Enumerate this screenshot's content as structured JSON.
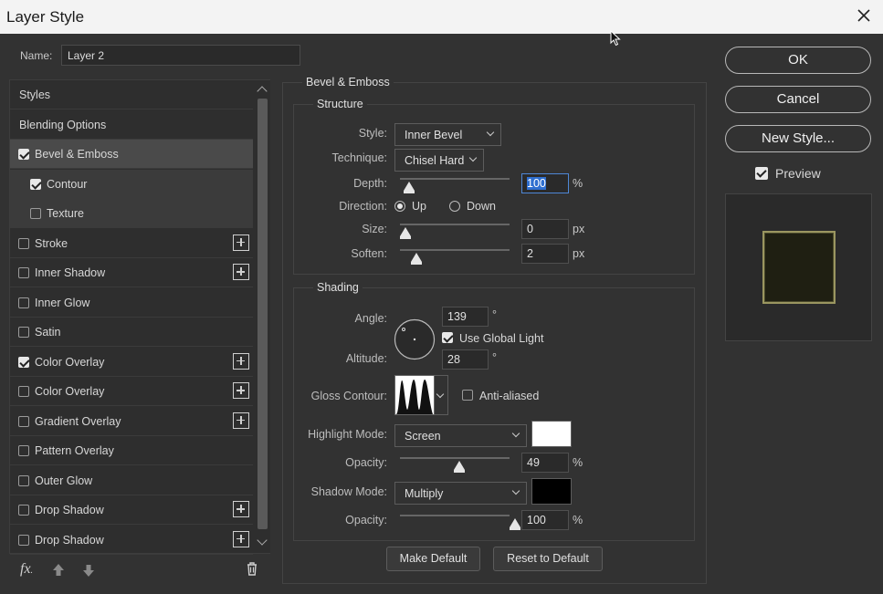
{
  "window": {
    "title": "Layer Style"
  },
  "name": {
    "label": "Name:",
    "value": "Layer 2"
  },
  "style_list": [
    {
      "label": "Styles",
      "checkbox": false,
      "checked": false,
      "plus": false,
      "state": "normal",
      "indent": false
    },
    {
      "label": "Blending Options",
      "checkbox": false,
      "checked": false,
      "plus": false,
      "state": "normal",
      "indent": false
    },
    {
      "label": "Bevel & Emboss",
      "checkbox": true,
      "checked": true,
      "plus": false,
      "state": "selected",
      "indent": false
    },
    {
      "label": "Contour",
      "checkbox": true,
      "checked": true,
      "plus": false,
      "state": "sub",
      "indent": true
    },
    {
      "label": "Texture",
      "checkbox": true,
      "checked": false,
      "plus": false,
      "state": "sub",
      "indent": true
    },
    {
      "label": "Stroke",
      "checkbox": true,
      "checked": false,
      "plus": true,
      "state": "normal",
      "indent": false
    },
    {
      "label": "Inner Shadow",
      "checkbox": true,
      "checked": false,
      "plus": true,
      "state": "normal",
      "indent": false
    },
    {
      "label": "Inner Glow",
      "checkbox": true,
      "checked": false,
      "plus": false,
      "state": "normal",
      "indent": false
    },
    {
      "label": "Satin",
      "checkbox": true,
      "checked": false,
      "plus": false,
      "state": "normal",
      "indent": false
    },
    {
      "label": "Color Overlay",
      "checkbox": true,
      "checked": true,
      "plus": true,
      "state": "normal",
      "indent": false
    },
    {
      "label": "Color Overlay",
      "checkbox": true,
      "checked": false,
      "plus": true,
      "state": "normal",
      "indent": false
    },
    {
      "label": "Gradient Overlay",
      "checkbox": true,
      "checked": false,
      "plus": true,
      "state": "normal",
      "indent": false
    },
    {
      "label": "Pattern Overlay",
      "checkbox": true,
      "checked": false,
      "plus": false,
      "state": "normal",
      "indent": false
    },
    {
      "label": "Outer Glow",
      "checkbox": true,
      "checked": false,
      "plus": false,
      "state": "normal",
      "indent": false
    },
    {
      "label": "Drop Shadow",
      "checkbox": true,
      "checked": false,
      "plus": true,
      "state": "normal",
      "indent": false
    },
    {
      "label": "Drop Shadow",
      "checkbox": true,
      "checked": false,
      "plus": true,
      "state": "normal",
      "indent": false
    }
  ],
  "footer": {
    "fx_label": "fx"
  },
  "bevel": {
    "title": "Bevel & Emboss",
    "structure": {
      "title": "Structure",
      "style": {
        "label": "Style:",
        "value": "Inner Bevel"
      },
      "technique": {
        "label": "Technique:",
        "value": "Chisel Hard"
      },
      "depth": {
        "label": "Depth:",
        "value": "100",
        "unit": "%",
        "level": 0.03
      },
      "direction": {
        "label": "Direction:",
        "up": "Up",
        "down": "Down",
        "selected": "Up"
      },
      "size": {
        "label": "Size:",
        "value": "0",
        "unit": "px",
        "level": 0.0
      },
      "soften": {
        "label": "Soften:",
        "value": "2",
        "unit": "px",
        "level": 0.1
      }
    },
    "shading": {
      "title": "Shading",
      "angle": {
        "label": "Angle:",
        "value": "139",
        "unit": "°"
      },
      "use_global_light": {
        "label": "Use Global Light",
        "checked": true
      },
      "altitude": {
        "label": "Altitude:",
        "value": "28",
        "unit": "°"
      },
      "gloss_contour": {
        "label": "Gloss Contour:"
      },
      "anti_aliased": {
        "label": "Anti-aliased",
        "checked": false
      },
      "highlight_mode": {
        "label": "Highlight Mode:",
        "value": "Screen",
        "color": "#ffffff"
      },
      "highlight_opacity": {
        "label": "Opacity:",
        "value": "49",
        "unit": "%",
        "level": 0.49
      },
      "shadow_mode": {
        "label": "Shadow Mode:",
        "value": "Multiply",
        "color": "#000000"
      },
      "shadow_opacity": {
        "label": "Opacity:",
        "value": "100",
        "unit": "%",
        "level": 1.0
      }
    },
    "buttons": {
      "make_default": "Make Default",
      "reset_default": "Reset to Default"
    }
  },
  "actions": {
    "ok": "OK",
    "cancel": "Cancel",
    "new_style": "New Style...",
    "preview": {
      "label": "Preview",
      "checked": true
    }
  },
  "colors": {
    "accent": "#2f6fd0",
    "preview_fill": "#1f1f12",
    "preview_border": "#9a9660"
  }
}
